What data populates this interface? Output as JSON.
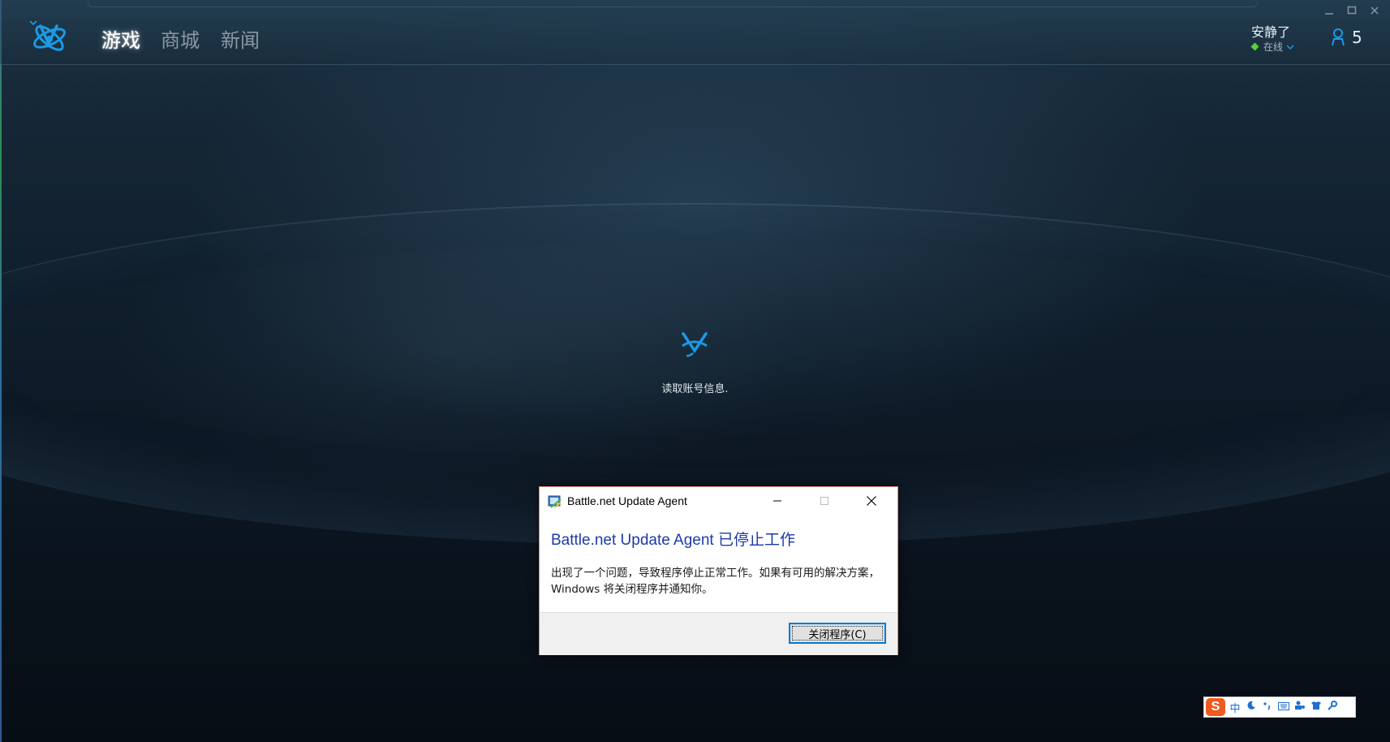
{
  "nav": {
    "items": [
      "游戏",
      "商城",
      "新闻"
    ]
  },
  "user": {
    "name": "安静了",
    "status": "在线",
    "friends_count": "5"
  },
  "loading": {
    "text": "读取账号信息."
  },
  "dialog": {
    "title": "Battle.net Update Agent",
    "heading": "Battle.net Update Agent 已停止工作",
    "body": "出现了一个问题，导致程序停止正常工作。如果有可用的解决方案，Windows 将关闭程序并通知你。",
    "close_button": "关闭程序(C)"
  },
  "ime": {
    "logo": "S",
    "mode": "中"
  },
  "colors": {
    "accent": "#1a9ae6",
    "status_online": "#5ad13a",
    "dialog_heading": "#1c3aa9"
  },
  "icons": {
    "logo": "battlenet-logo-icon",
    "friends": "friends-icon",
    "loading": "battlenet-spinner-icon",
    "dialog_app": "update-agent-icon"
  }
}
